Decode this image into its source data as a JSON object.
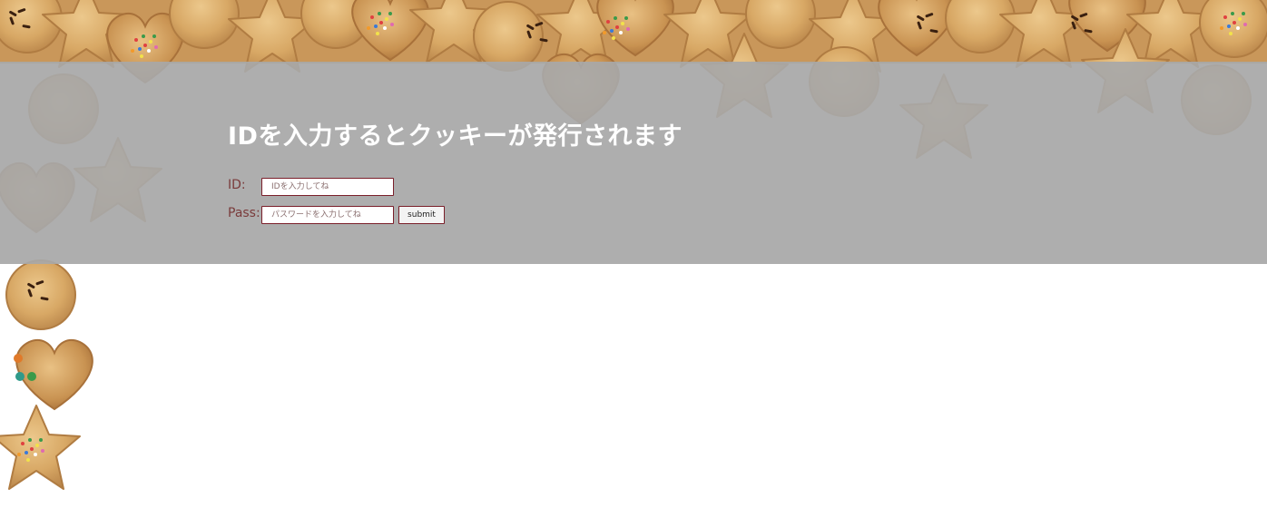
{
  "header": {
    "title": "IDを入力するとクッキーが発行されます"
  },
  "login_form": {
    "id_label": "ID:",
    "id_placeholder": "IDを入力してね",
    "id_value": "",
    "pass_label": "Pass:",
    "pass_placeholder": "パスワードを入力してね",
    "pass_value": "",
    "submit_label": "submit"
  },
  "colors": {
    "band": "#a8a8a8",
    "title_text": "#ffffff",
    "label_text": "#7a3b3b",
    "field_border": "#7a1f2a",
    "cookie_base": "#d6a866",
    "background": "#ffffff"
  },
  "background_image": {
    "icon": "cookie-pattern"
  }
}
